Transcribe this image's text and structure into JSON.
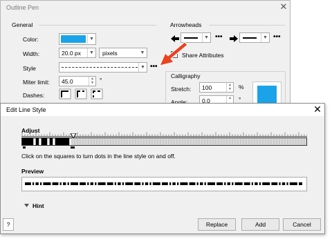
{
  "outline_pen": {
    "title": "Outline Pen",
    "close_glyph": "✕",
    "general": {
      "label": "General",
      "color_label": "Color:",
      "color_value": "#1aa3e8",
      "width_label": "Width:",
      "width_value": "20.0 px",
      "units_value": "pixels",
      "style_label": "Style",
      "miter_label": "Miter limit:",
      "miter_value": "45.0",
      "miter_unit": "°",
      "dashes_label": "Dashes:",
      "more_glyph": "•••"
    },
    "arrowheads": {
      "label": "Arrowheads",
      "share_label": "Share Attributes",
      "more_glyph": "•••"
    },
    "calligraphy": {
      "label": "Calligraphy",
      "stretch_label": "Stretch:",
      "stretch_value": "100",
      "stretch_unit": "%",
      "angle_label": "Angle:",
      "angle_value": "0.0",
      "angle_unit": "°",
      "nib_color": "#1aa3e8"
    }
  },
  "edit_line_style": {
    "title": "Edit Line Style",
    "close_glyph": "✕",
    "adjust_label": "Adjust",
    "instruction": "Click on the squares to turn dots in the line style on and off.",
    "preview_label": "Preview",
    "hint_label": "Hint",
    "help_glyph": "?",
    "buttons": {
      "replace": "Replace",
      "add": "Add",
      "cancel": "Cancel"
    },
    "pattern": [
      1,
      1,
      1,
      1,
      0,
      1,
      0,
      1,
      1,
      0,
      1,
      0,
      1,
      1,
      1,
      1,
      1,
      0
    ],
    "accent": "#ea4221"
  }
}
